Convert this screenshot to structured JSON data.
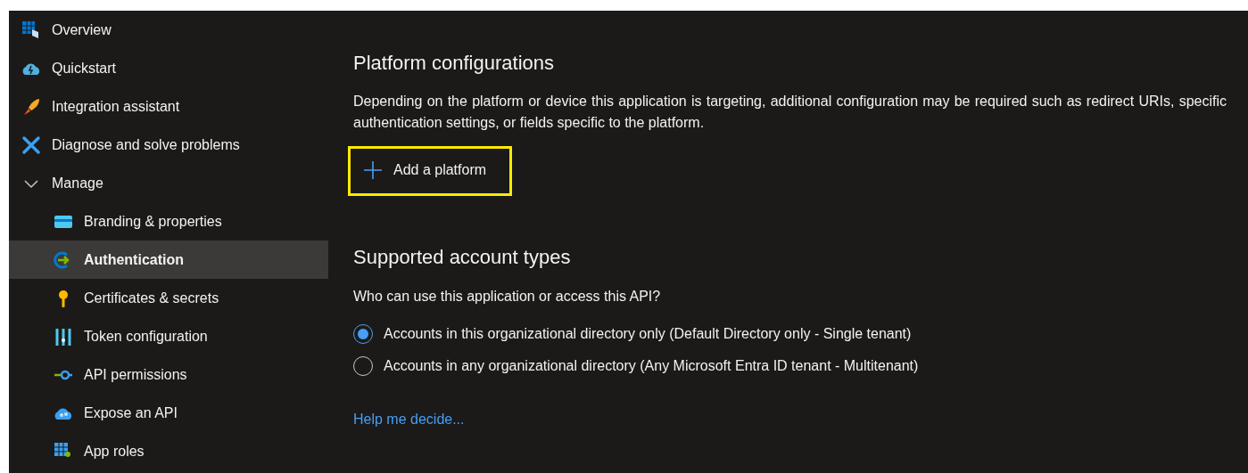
{
  "sidebar": {
    "items": [
      {
        "label": "Overview",
        "selected": false
      },
      {
        "label": "Quickstart",
        "selected": false
      },
      {
        "label": "Integration assistant",
        "selected": false
      },
      {
        "label": "Diagnose and solve problems",
        "selected": false
      },
      {
        "label": "Manage",
        "selected": false,
        "expanded": true,
        "children": [
          {
            "label": "Branding & properties",
            "selected": false
          },
          {
            "label": "Authentication",
            "selected": true
          },
          {
            "label": "Certificates & secrets",
            "selected": false
          },
          {
            "label": "Token configuration",
            "selected": false
          },
          {
            "label": "API permissions",
            "selected": false
          },
          {
            "label": "Expose an API",
            "selected": false
          },
          {
            "label": "App roles",
            "selected": false
          }
        ]
      }
    ]
  },
  "platform_configurations": {
    "title": "Platform configurations",
    "description": "Depending on the platform or device this application is targeting, additional configuration may be required such as redirect URIs, specific authentication settings, or fields specific to the platform.",
    "add_button": {
      "label": "Add a platform",
      "highlighted": true
    }
  },
  "supported_account_types": {
    "title": "Supported account types",
    "question": "Who can use this application or access this API?",
    "options": [
      {
        "label": "Accounts in this organizational directory only (Default Directory only - Single tenant)",
        "selected": true
      },
      {
        "label": "Accounts in any organizational directory (Any Microsoft Entra ID tenant - Multitenant)",
        "selected": false
      }
    ],
    "help_link": "Help me decide..."
  }
}
